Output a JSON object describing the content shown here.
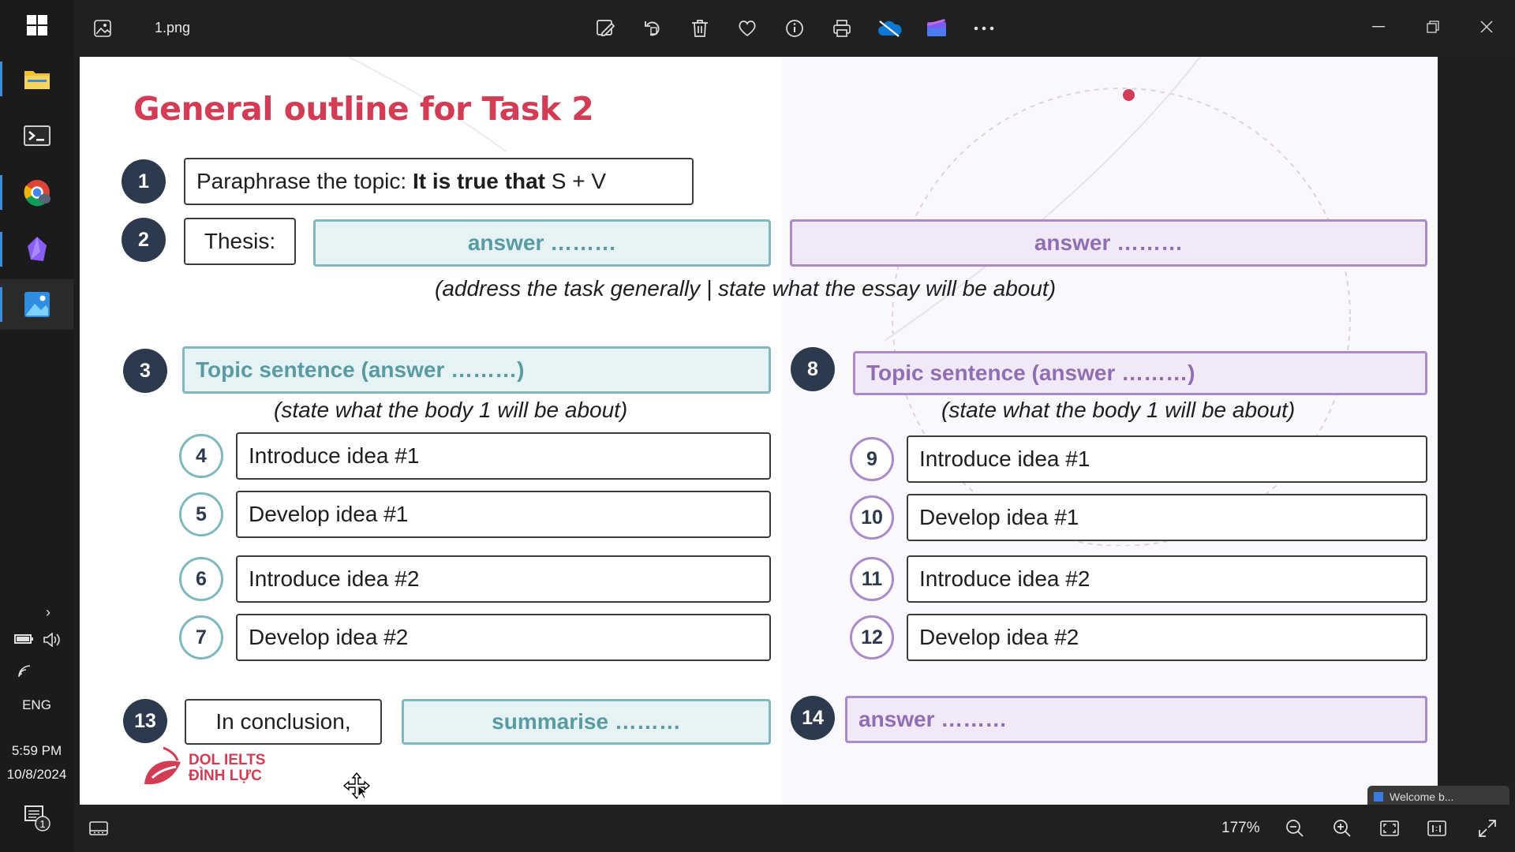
{
  "taskbar": {
    "language": "ENG",
    "time": "5:59 PM",
    "date": "10/8/2024",
    "notification_count": "1"
  },
  "viewer": {
    "file_name": "1.png",
    "zoom": "177%"
  },
  "slide": {
    "title": "General outline for Task 2",
    "intro": {
      "step1_number": "1",
      "paraphrase_prefix": "Paraphrase the topic: ",
      "paraphrase_bold": "It is true that",
      "paraphrase_suffix": " S + V",
      "step2_number": "2",
      "thesis_label": "Thesis:",
      "answer_left": "answer ………",
      "answer_right": "answer ………",
      "note": "(address the task generally | state what the essay will be about)"
    },
    "body_left": {
      "number": "3",
      "topic": "Topic sentence (answer ………)",
      "note": "(state what the body 1 will be about)",
      "items": [
        {
          "number": "4",
          "text": "Introduce idea #1"
        },
        {
          "number": "5",
          "text": "Develop idea #1"
        },
        {
          "number": "6",
          "text": "Introduce idea #2"
        },
        {
          "number": "7",
          "text": "Develop idea #2"
        }
      ]
    },
    "body_right": {
      "number": "8",
      "topic": "Topic sentence (answer ………)",
      "note": "(state what the body 1 will be about)",
      "items": [
        {
          "number": "9",
          "text": "Introduce idea #1"
        },
        {
          "number": "10",
          "text": "Develop idea #1"
        },
        {
          "number": "11",
          "text": "Introduce idea #2"
        },
        {
          "number": "12",
          "text": "Develop idea #2"
        }
      ]
    },
    "conclusion": {
      "number_left": "13",
      "label": "In conclusion,",
      "summarise": "summarise ………",
      "number_right": "14",
      "answer": "answer ………"
    },
    "logo": {
      "line1": "DOL IELTS",
      "line2": "ĐÌNH LỰC"
    }
  },
  "overlay": {
    "welcome": "Welcome b..."
  },
  "colors": {
    "title_red": "#d23c55",
    "navy": "#2d3a4e",
    "teal": "#7fb8bf",
    "purple": "#a98bc8"
  }
}
